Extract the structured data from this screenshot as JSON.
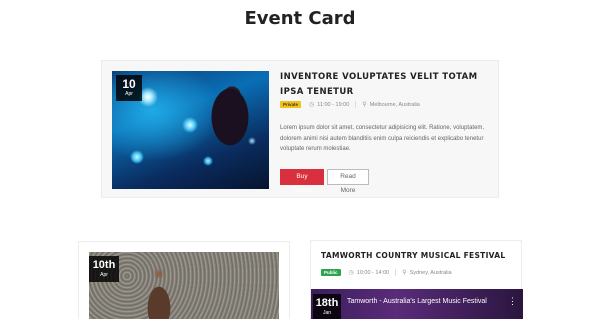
{
  "page": {
    "title": "Event Card"
  },
  "featured": {
    "date_day": "10",
    "date_month": "Apr",
    "title": "INVENTORE VOLUPTATES VELIT TOTAM IPSA TENETUR",
    "badge": "Private",
    "time": "11:00 - 19:00",
    "location": "Melbourne, Australia",
    "description": "Lorem ipsum dolor sit amet, consectetur adipisicing elit. Ratione, voluptatem, dolorem animi nisi autem blanditiis enim culpa reiciendis et explicabo tenetur voluptate rerum molestiae.",
    "buy_label": "Buy Tickets",
    "more_label": "Read More",
    "image_icon": "concert-photo",
    "colors": {
      "buy": "#d9303e",
      "badge": "#f3c21a"
    }
  },
  "card_left": {
    "date_day": "10th",
    "date_month": "Apr",
    "image_icon": "crowd-photo"
  },
  "card_right": {
    "title": "TAMWORTH COUNTRY MUSICAL FESTIVAL",
    "badge": "Public",
    "time": "10:00 - 14:00",
    "location": "Sydney, Australia",
    "date_day": "18th",
    "date_month": "Jan",
    "video_title": "Tamworth - Australia's Largest Music Festival",
    "video_menu_icon": "more-vertical-icon",
    "colors": {
      "badge": "#2ea44f"
    }
  },
  "icons": {
    "time": "clock-icon",
    "location": "map-pin-icon"
  }
}
